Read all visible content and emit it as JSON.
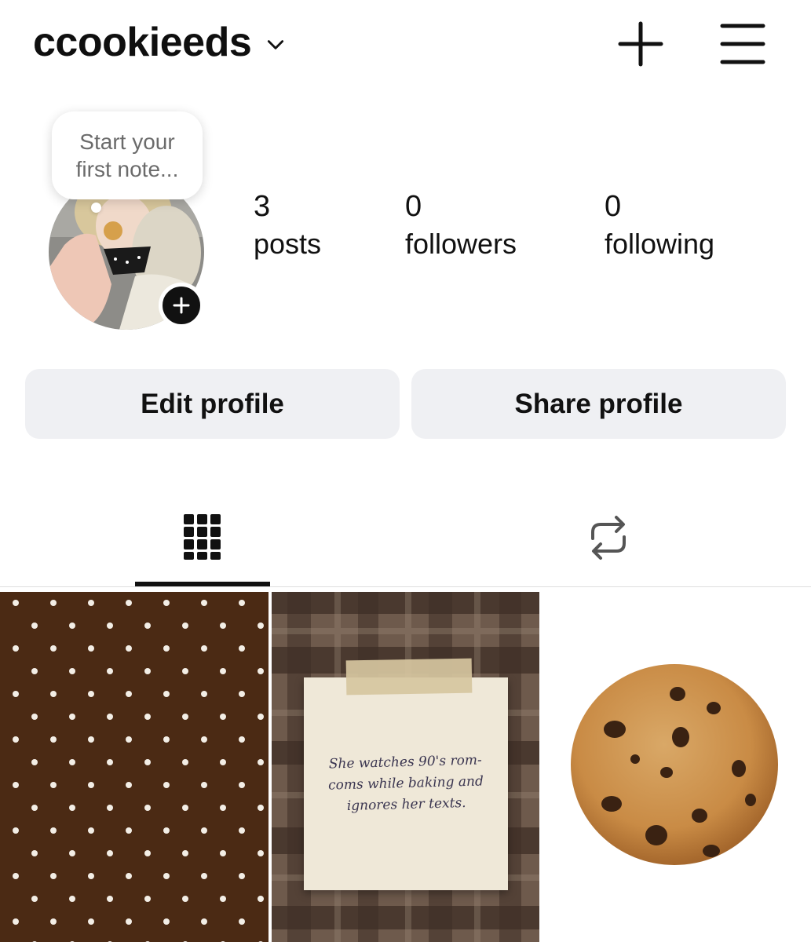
{
  "header": {
    "username": "ccookieeds",
    "icons": {
      "dropdown": "chevron-down-icon",
      "create": "plus-icon",
      "menu": "hamburger-menu-icon"
    }
  },
  "note": {
    "placeholder": "Start your first note..."
  },
  "stats": [
    {
      "value": "3",
      "label": "posts"
    },
    {
      "value": "0",
      "label": "followers"
    },
    {
      "value": "0",
      "label": "following"
    }
  ],
  "buttons": {
    "edit": "Edit profile",
    "share": "Share profile"
  },
  "tabs": [
    {
      "icon": "grid-icon",
      "active": true
    },
    {
      "icon": "repost-icon",
      "active": false
    }
  ],
  "posts": [
    {
      "kind": "polka-dot-pattern"
    },
    {
      "kind": "paper-note",
      "text": "She watches 90's rom-coms while baking and ignores her texts."
    },
    {
      "kind": "chocolate-chip-cookie"
    }
  ],
  "colors": {
    "accent": "#111111",
    "button_bg": "#eff0f3",
    "pattern_brown": "#4b2a14"
  }
}
